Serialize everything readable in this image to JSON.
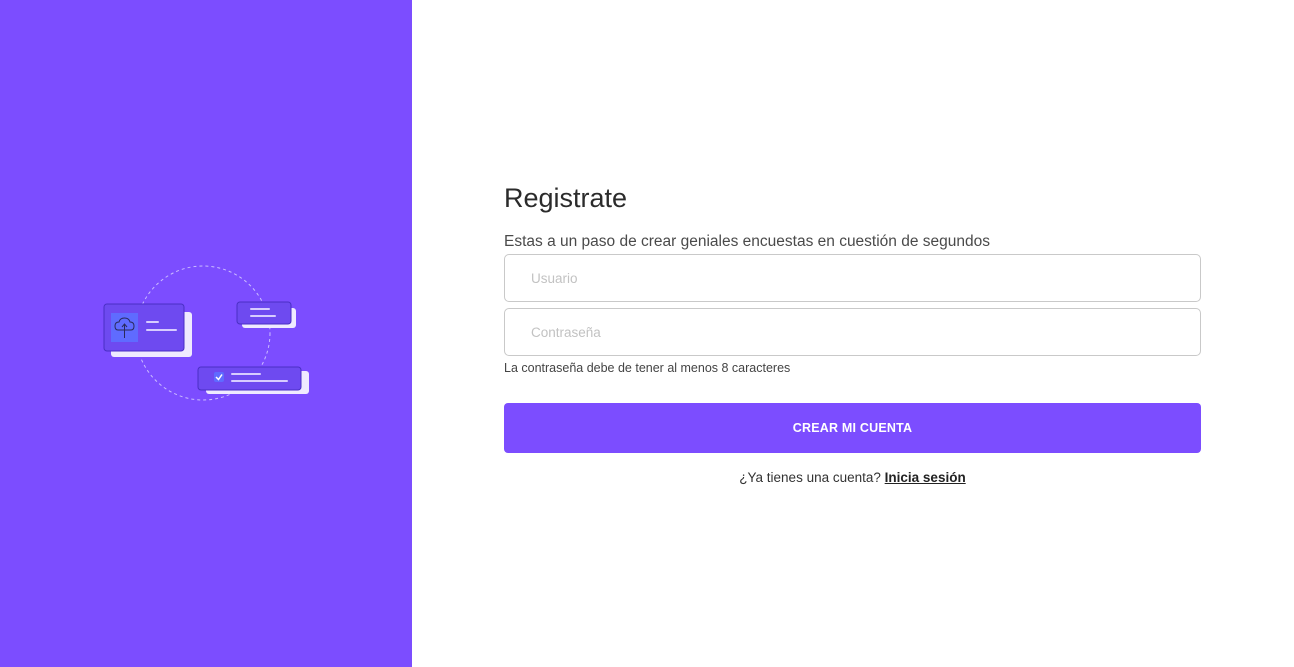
{
  "colors": {
    "brand": "#7c4dff",
    "card": "#6e4af0",
    "card_shadow": "#efeaff",
    "line": "#d7ccff",
    "icon_tile": "#5f6bff"
  },
  "illustration": {
    "icons": [
      "cloud-upload-icon",
      "checkmark-icon"
    ]
  },
  "form": {
    "title": "Registrate",
    "subtitle": "Estas a un paso de crear geniales encuestas en cuestión de segundos",
    "username_placeholder": "Usuario",
    "password_placeholder": "Contraseña",
    "password_hint": "La contraseña debe de tener al menos 8 caracteres",
    "submit_label": "CREAR MI CUENTA",
    "login_prompt": "¿Ya tienes una cuenta?",
    "login_link": "Inicia sesión"
  }
}
